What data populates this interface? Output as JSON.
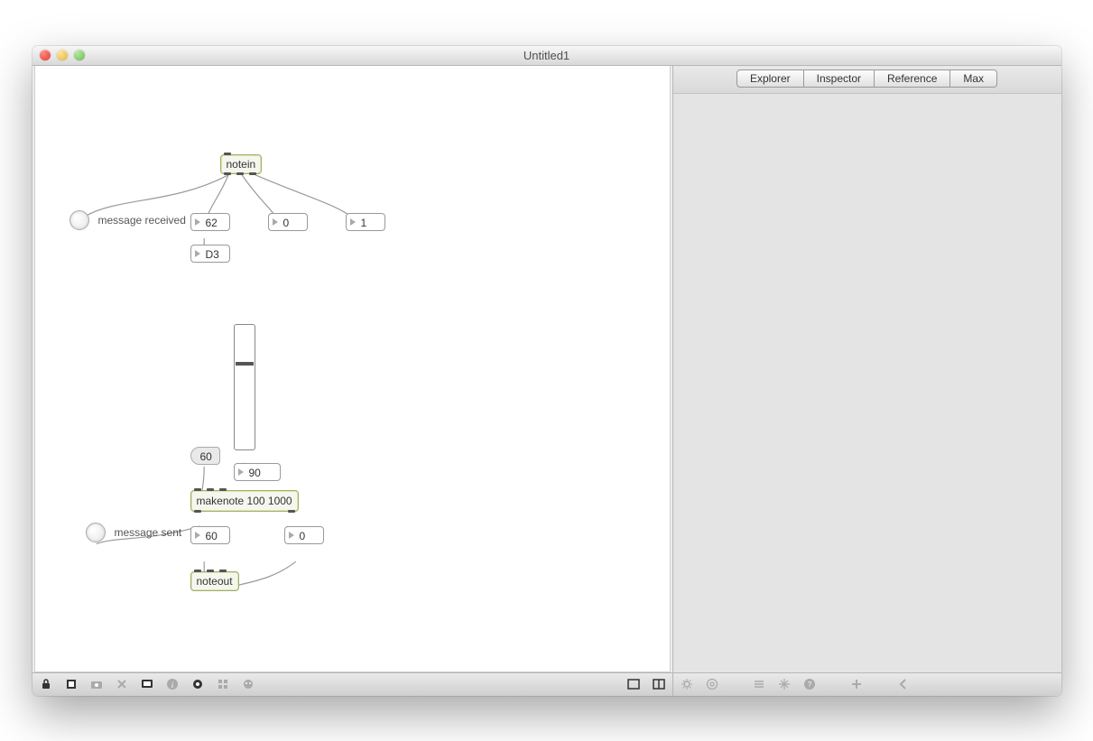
{
  "window": {
    "title": "Untitled1"
  },
  "tabs": [
    "Explorer",
    "Inspector",
    "Reference",
    "Max"
  ],
  "patcher": {
    "notein_label": "notein",
    "message_received": "message received",
    "pitch_value": "62",
    "velocity_value": "0",
    "channel_value": "1",
    "note_name": "D3",
    "msg60": "60",
    "slider_out": "90",
    "makenote": "makenote 100 1000",
    "message_sent": "message sent",
    "out_pitch": "60",
    "out_velocity": "0",
    "noteout_label": "noteout"
  },
  "slider": {
    "pos_percent": 30
  },
  "toolbar_left_icons": [
    "lock-icon",
    "new-patcher-icon",
    "camera-icon",
    "x-icon",
    "presentation-icon",
    "info-icon",
    "clue-icon",
    "grid-icon",
    "debug-icon"
  ],
  "toolbar_left_enabled": [
    true,
    true,
    false,
    false,
    true,
    false,
    true,
    false,
    false
  ],
  "toolbar_right_view_icons": [
    "single-view-icon",
    "split-view-icon"
  ],
  "right_toolbar_icons": [
    "settings-icon",
    "at-icon",
    "list-icon",
    "snowflake-icon",
    "help-icon",
    "plus-icon",
    "back-icon"
  ]
}
